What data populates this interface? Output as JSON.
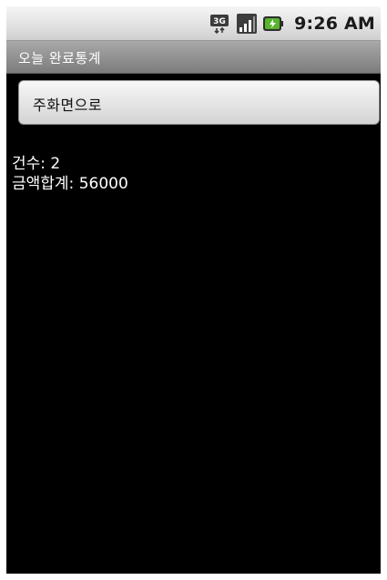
{
  "status_bar": {
    "time": "9:26 AM",
    "icons": [
      "network-3g-icon",
      "signal-strength-icon",
      "battery-charging-icon"
    ]
  },
  "title_bar": {
    "title": "오늘 완료통계"
  },
  "home_button": {
    "label": "주화면으로"
  },
  "stats": {
    "count_label": "건수: ",
    "count_value": "2",
    "total_label": "금액합계: ",
    "total_value": "56000"
  }
}
